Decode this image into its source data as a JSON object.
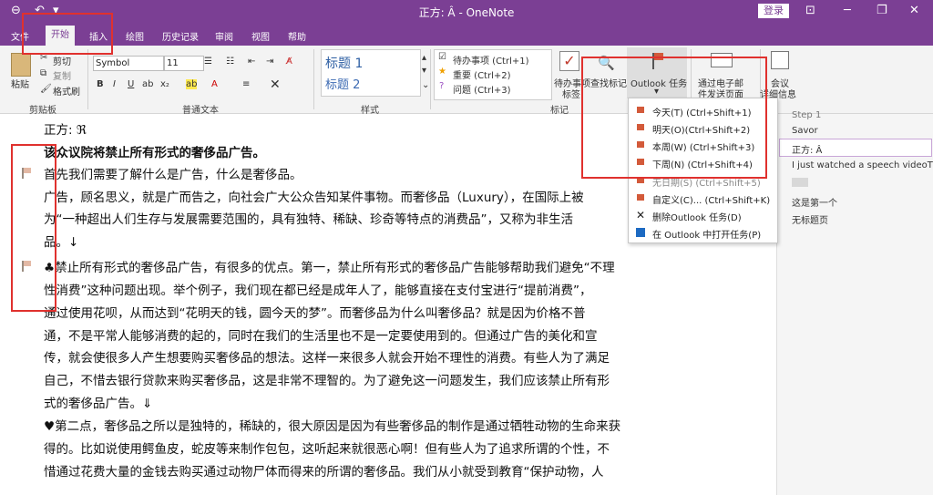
{
  "titlebar": {
    "title": "正方: Â  -  OneNote",
    "login": "登录"
  },
  "tabs": [
    "文件",
    "开始",
    "插入",
    "绘图",
    "历史记录",
    "审阅",
    "视图",
    "帮助"
  ],
  "clipboard": {
    "paste": "粘贴",
    "cut": "剪切",
    "copy": "复制",
    "format_painter": "格式刷",
    "label": "剪贴板"
  },
  "basic_text": {
    "font": "Symbol",
    "size": "11",
    "label": "普通文本"
  },
  "styles": {
    "h1": "标题 1",
    "h2": "标题 2",
    "label": "样式"
  },
  "tags": {
    "items": [
      "待办事项 (Ctrl+1)",
      "重要 (Ctrl+2)",
      "问题 (Ctrl+3)"
    ],
    "todo_tag": "待办事项",
    "todo_tag2": "标签",
    "find": "查找标记",
    "outlook": "Outlook 任务",
    "label": "标记"
  },
  "email": {
    "line1": "通过电子邮",
    "line2": "件发送页面"
  },
  "meeting": {
    "line1": "会议",
    "line2": "详细信息"
  },
  "dropdown": [
    "今天(T)  (Ctrl+Shift+1)",
    "明天(O)(Ctrl+Shift+2)",
    "本周(W)  (Ctrl+Shift+3)",
    "下周(N)  (Ctrl+Shift+4)",
    "无日期(S)  (Ctrl+Shift+5)",
    "自定义(C)...  (Ctrl+Shift+K)",
    "删除Outlook 任务(D)",
    "在 Outlook 中打开任务(P)"
  ],
  "pages": [
    "Step 1",
    "Savor",
    "正方: Â",
    "I just watched a speech videoTh",
    "这是第一个",
    "无标题页"
  ],
  "content": {
    "title": "正方: ℜ",
    "lines": [
      "该众议院将禁止所有形式的奢侈品广告。",
      "首先我们需要了解什么是广告，什么是奢侈品。",
      "广告，顾名思义，就是广而告之，向社会广大公众告知某件事物。而奢侈品（Luxury），在国际上被",
      "为“一种超出人们生存与发展需要范围的，具有独特、稀缺、珍奇等特点的消费品”，又称为非生活",
      "品。↓",
      "♣禁止所有形式的奢侈品广告，有很多的优点。第一，禁止所有形式的奢侈品广告能够帮助我们避免“不理",
      "性消费”这种问题出现。举个例子，我们现在都已经是成年人了，能够直接在支付宝进行“提前消费”，",
      "通过使用花呗，从而达到“花明天的钱，圆今天的梦”。而奢侈品为什么叫奢侈品？就是因为价格不普",
      "通，不是平常人能够消费的起的，同时在我们的生活里也不是一定要使用到的。但通过广告的美化和宣",
      "传，就会使很多人产生想要购买奢侈品的想法。这样一来很多人就会开始不理性的消费。有些人为了满足",
      "自己，不惜去银行贷款来购买奢侈品，这是非常不理智的。为了避免这一问题发生，我们应该禁止所有形",
      "式的奢侈品广告。⇓",
      "♥第二点，奢侈品之所以是独特的，稀缺的，很大原因是因为有些奢侈品的制作是通过牺牲动物的生命来获",
      "得的。比如说使用鳄鱼皮，蛇皮等来制作包包，这听起来就很恶心啊！但有些人为了追求所谓的个性，不",
      "惜通过花费大量的金钱去购买通过动物尸体而得来的所谓的奢侈品。我们从小就受到教育“保护动物，人"
    ]
  }
}
